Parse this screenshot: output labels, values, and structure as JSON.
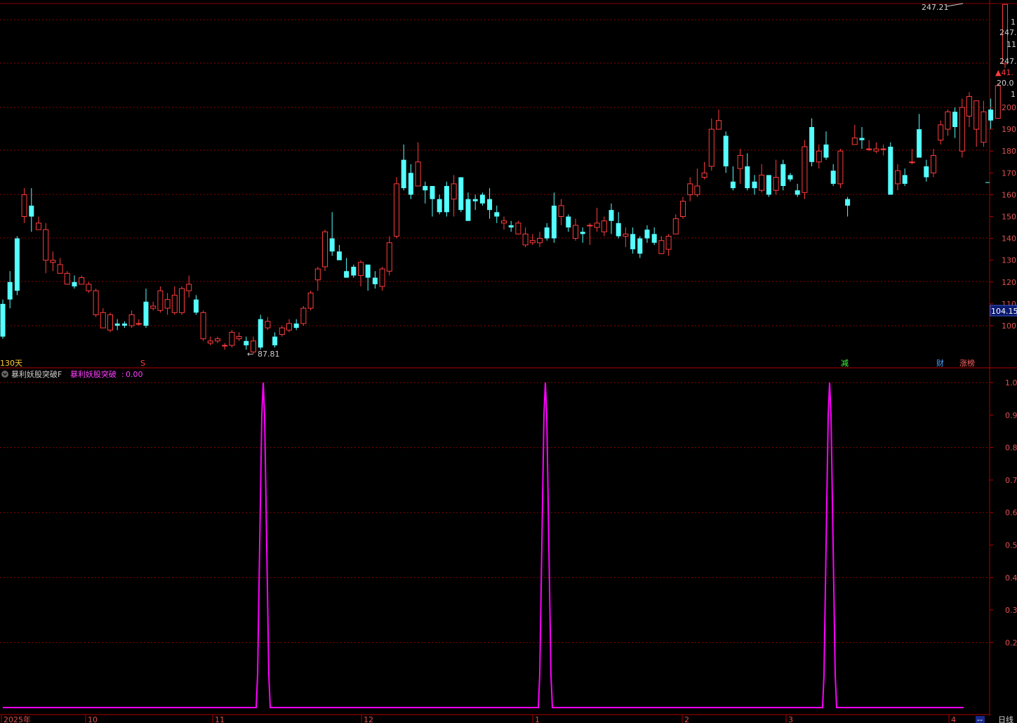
{
  "main_panel": {
    "peak_label": "247.21",
    "low_label": "87.81",
    "low_arrow": "←",
    "period_label": "130天",
    "marker_s": "S",
    "marker_reduce": "减",
    "marker_fin": "财",
    "marker_limit": "涨榜",
    "current_price_label": "104.15"
  },
  "right_axis": {
    "top_labels": [
      "247.",
      "11",
      "247.",
      "▲41.",
      "20.0"
    ],
    "price_ticks": [
      "200",
      "190",
      "180",
      "170",
      "160",
      "150",
      "140",
      "130",
      "120",
      "110",
      "100"
    ]
  },
  "indicator_panel": {
    "name": "暴利妖股突破F",
    "series_label": "暴利妖股突破",
    "series_value": "0.00",
    "ticks": [
      "1.0",
      "0.9",
      "0.8",
      "0.7",
      "0.6",
      "0.5",
      "0.4",
      "0.3",
      "0.2"
    ]
  },
  "x_axis": {
    "labels": [
      "2025年",
      "10",
      "11",
      "12",
      "1",
      "2",
      "3",
      "4"
    ]
  },
  "bottom_right": {
    "button": "--",
    "period": "日线"
  },
  "colors": {
    "up": "#ff3c3c",
    "down": "#54ffff",
    "indicator": "#ff00ff",
    "grid": "#8b0000"
  },
  "chart_data": [
    {
      "type": "candlestick",
      "title": "",
      "xlabel": "",
      "ylabel": "",
      "ylim": [
        85,
        250
      ],
      "y_ticks": [
        100,
        110,
        120,
        130,
        140,
        150,
        160,
        170,
        180,
        190,
        200
      ],
      "current_price": 104.15,
      "peak": 247.21,
      "low": 87.81,
      "candles": [
        [
          110.0,
          95.0,
          112.0,
          94.0
        ],
        [
          120.0,
          112.0,
          125.0,
          108.0
        ],
        [
          140.0,
          116.0,
          141.0,
          114.0
        ],
        [
          150.0,
          160.0,
          163.0,
          147.0
        ],
        [
          155.0,
          150.0,
          163.0,
          143.0
        ],
        [
          144.0,
          147.0,
          150.0,
          145.0
        ],
        [
          130.0,
          144.0,
          147.0,
          124.0
        ],
        [
          129.0,
          130.0,
          134.0,
          125.0
        ],
        [
          124.0,
          128.0,
          131.0,
          124.0
        ],
        [
          119.0,
          124.0,
          125.0,
          119.0
        ],
        [
          120.0,
          118.0,
          123.0,
          117.0
        ],
        [
          119.0,
          122.0,
          123.0,
          119.0
        ],
        [
          116.0,
          119.0,
          120.0,
          115.0
        ],
        [
          105.0,
          116.0,
          117.0,
          104.0
        ],
        [
          99.0,
          106.0,
          108.0,
          99.0
        ],
        [
          98.0,
          105.0,
          106.0,
          97.0
        ],
        [
          101.0,
          100.0,
          103.0,
          98.0
        ],
        [
          101.0,
          100.0,
          102.0,
          99.0
        ],
        [
          100.0,
          105.0,
          107.0,
          99.0
        ],
        [
          101.0,
          101.0,
          103.0,
          100.0
        ],
        [
          111.0,
          100.0,
          117.0,
          99.0
        ],
        [
          108.0,
          109.0,
          111.0,
          107.0
        ],
        [
          107.0,
          116.0,
          118.0,
          106.0
        ],
        [
          108.0,
          112.0,
          115.0,
          105.0
        ],
        [
          106.0,
          114.0,
          118.0,
          105.0
        ],
        [
          106.0,
          117.0,
          118.0,
          105.0
        ],
        [
          116.0,
          119.0,
          123.0,
          113.0
        ],
        [
          112.0,
          106.0,
          114.0,
          105.0
        ],
        [
          94.0,
          106.0,
          107.0,
          93.0
        ],
        [
          92.0,
          93.0,
          95.0,
          91.0
        ],
        [
          93.0,
          94.0,
          95.0,
          92.0
        ],
        [
          91.0,
          91.0,
          92.0,
          89.0
        ],
        [
          91.0,
          97.0,
          98.0,
          90.0
        ],
        [
          94.0,
          95.0,
          97.0,
          93.0
        ],
        [
          93.0,
          91.0,
          95.0,
          89.0
        ],
        [
          88.0,
          93.0,
          95.0,
          87.0
        ],
        [
          103.0,
          90.0,
          105.0,
          89.0
        ],
        [
          99.0,
          102.0,
          104.0,
          98.0
        ],
        [
          95.0,
          91.0,
          97.0,
          90.0
        ],
        [
          96.0,
          99.0,
          100.0,
          95.0
        ],
        [
          98.0,
          101.0,
          103.0,
          97.0
        ],
        [
          101.0,
          99.0,
          103.0,
          98.0
        ],
        [
          101.0,
          108.0,
          109.0,
          100.0
        ],
        [
          108.0,
          115.0,
          116.0,
          107.0
        ],
        [
          121.0,
          126.0,
          127.0,
          116.0
        ],
        [
          127.0,
          143.0,
          144.0,
          125.0
        ],
        [
          140.0,
          134.0,
          152.0,
          132.0
        ],
        [
          134.0,
          130.0,
          137.0,
          131.0
        ],
        [
          125.0,
          122.0,
          131.0,
          122.0
        ],
        [
          127.0,
          123.0,
          128.0,
          122.0
        ],
        [
          123.0,
          129.0,
          130.0,
          118.0
        ],
        [
          128.0,
          122.0,
          124.0,
          116.0
        ],
        [
          122.0,
          119.0,
          125.0,
          117.0
        ],
        [
          118.0,
          126.0,
          127.0,
          116.0
        ],
        [
          125.0,
          138.0,
          141.0,
          123.0
        ],
        [
          141.0,
          165.0,
          168.0,
          140.0
        ],
        [
          176.0,
          163.0,
          183.0,
          162.0
        ],
        [
          170.0,
          160.0,
          174.0,
          158.0
        ],
        [
          164.0,
          175.0,
          184.0,
          165.0
        ],
        [
          164.0,
          162.0,
          166.0,
          156.0
        ],
        [
          164.0,
          158.0,
          164.0,
          150.0
        ],
        [
          158.0,
          152.0,
          160.0,
          151.0
        ],
        [
          164.0,
          152.0,
          166.0,
          150.0
        ],
        [
          158.0,
          165.0,
          169.0,
          150.0
        ],
        [
          168.0,
          153.0,
          168.0,
          152.0
        ],
        [
          158.0,
          148.0,
          161.0,
          149.0
        ],
        [
          158.0,
          157.0,
          160.0,
          153.0
        ],
        [
          160.0,
          156.0,
          161.0,
          155.0
        ],
        [
          158.0,
          153.0,
          163.0,
          149.0
        ],
        [
          152.0,
          150.0,
          155.0,
          147.0
        ],
        [
          147.0,
          148.0,
          150.0,
          144.0
        ],
        [
          146.0,
          145.0,
          148.0,
          143.0
        ],
        [
          142.0,
          147.0,
          148.0,
          143.0
        ],
        [
          137.0,
          142.0,
          145.0,
          136.0
        ],
        [
          138.0,
          139.0,
          142.0,
          137.0
        ],
        [
          138.0,
          140.0,
          143.0,
          136.0
        ],
        [
          145.0,
          140.0,
          147.0,
          139.0
        ],
        [
          155.0,
          140.0,
          161.0,
          138.0
        ],
        [
          150.0,
          155.0,
          158.0,
          146.0
        ],
        [
          150.0,
          145.0,
          151.0,
          143.0
        ],
        [
          140.0,
          146.0,
          149.0,
          139.0
        ],
        [
          143.0,
          142.0,
          145.0,
          138.0
        ],
        [
          146.0,
          146.0,
          147.0,
          137.0
        ],
        [
          145.0,
          147.0,
          154.0,
          143.0
        ],
        [
          143.0,
          148.0,
          150.0,
          141.0
        ],
        [
          153.0,
          148.0,
          156.0,
          142.0
        ],
        [
          147.0,
          141.0,
          152.0,
          140.0
        ],
        [
          141.0,
          142.0,
          145.0,
          136.0
        ],
        [
          142.0,
          135.0,
          145.0,
          133.0
        ],
        [
          140.0,
          133.0,
          141.0,
          131.0
        ],
        [
          144.0,
          140.0,
          146.0,
          138.0
        ],
        [
          142.0,
          138.0,
          145.0,
          137.0
        ],
        [
          133.0,
          139.0,
          141.0,
          134.0
        ],
        [
          135.0,
          141.0,
          142.0,
          132.0
        ],
        [
          142.0,
          149.0,
          151.0,
          142.0
        ],
        [
          150.0,
          157.0,
          159.0,
          149.0
        ],
        [
          160.0,
          165.0,
          168.0,
          157.0
        ],
        [
          160.0,
          164.0,
          172.0,
          159.0
        ],
        [
          168.0,
          170.0,
          175.0,
          167.0
        ],
        [
          173.0,
          190.0,
          195.0,
          171.0
        ],
        [
          190.0,
          194.0,
          199.0,
          191.0
        ],
        [
          187.0,
          173.0,
          189.0,
          170.0
        ],
        [
          166.0,
          163.0,
          173.0,
          162.0
        ],
        [
          172.0,
          178.0,
          181.0,
          165.0
        ],
        [
          173.0,
          163.0,
          179.0,
          162.0
        ],
        [
          166.0,
          163.0,
          169.0,
          160.0
        ],
        [
          162.0,
          169.0,
          174.0,
          161.0
        ],
        [
          169.0,
          160.0,
          169.0,
          159.0
        ],
        [
          162.0,
          168.0,
          176.0,
          160.0
        ],
        [
          174.0,
          164.0,
          176.0,
          162.0
        ],
        [
          169.0,
          167.0,
          170.0,
          166.0
        ],
        [
          162.0,
          160.0,
          165.0,
          159.0
        ],
        [
          161.0,
          182.0,
          185.0,
          158.0
        ],
        [
          191.0,
          175.0,
          195.0,
          173.0
        ],
        [
          175.0,
          180.0,
          183.0,
          172.0
        ],
        [
          183.0,
          177.0,
          189.0,
          176.0
        ],
        [
          171.0,
          165.0,
          174.0,
          164.0
        ],
        [
          165.0,
          180.0,
          181.0,
          163.0
        ],
        [
          158.0,
          155.0,
          159.0,
          150.0
        ],
        [
          183.0,
          186.0,
          192.0,
          183.0
        ],
        [
          186.0,
          185.0,
          191.0,
          181.0
        ],
        [
          181.0,
          181.0,
          185.0,
          180.0
        ],
        [
          180.0,
          181.0,
          184.0,
          179.0
        ],
        [
          181.0,
          181.0,
          183.0,
          178.0
        ],
        [
          182.0,
          160.0,
          184.0,
          161.0
        ],
        [
          165.0,
          171.0,
          174.0,
          162.0
        ],
        [
          169.0,
          165.0,
          172.0,
          164.0
        ],
        [
          175.0,
          175.0,
          181.0,
          174.0
        ],
        [
          190.0,
          177.0,
          197.0,
          177.0
        ],
        [
          173.0,
          168.0,
          176.0,
          166.0
        ],
        [
          170.0,
          178.0,
          181.0,
          168.0
        ],
        [
          185.0,
          192.0,
          194.0,
          183.0
        ],
        [
          190.0,
          198.0,
          199.0,
          187.0
        ],
        [
          198.0,
          191.0,
          200.0,
          186.0
        ],
        [
          180.0,
          200.0,
          204.0,
          177.0
        ],
        [
          196.0,
          205.0,
          207.0,
          191.0
        ],
        [
          190.0,
          203.0,
          203.0,
          182.0
        ],
        [
          184.0,
          198.0,
          203.0,
          182.0
        ],
        [
          199.0,
          194.0,
          204.0,
          190.0
        ],
        [
          195.0,
          210.0,
          211.0,
          195.0
        ],
        [
          220.0,
          247.21,
          247.21,
          218.0
        ]
      ]
    },
    {
      "type": "line",
      "title": "",
      "series": [
        {
          "name": "暴利妖股突破"
        }
      ],
      "ylim": [
        0,
        1.0
      ],
      "baseline": 0.0,
      "pulses": [
        {
          "center": 364,
          "value": 1.0
        },
        {
          "center": 766,
          "value": 1.0
        },
        {
          "center": 1171,
          "value": 1.0
        }
      ]
    }
  ]
}
